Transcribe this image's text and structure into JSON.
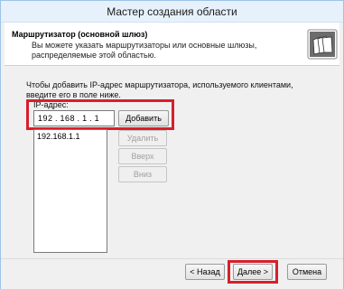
{
  "window": {
    "title": "Мастер создания области"
  },
  "header": {
    "title": "Маршрутизатор (основной шлюз)",
    "description": "Вы можете указать маршрутизаторы или основные шлюзы, распределяемые этой областью."
  },
  "main": {
    "intro": "Чтобы добавить IP-адрес маршрутизатора, используемого клиентами, введите его в поле ниже.",
    "ip_label": "IP-адрес:",
    "ip_octets": [
      "192",
      "168",
      "1",
      "1"
    ],
    "list_items": [
      "192.168.1.1"
    ],
    "buttons": {
      "add": "Добавить",
      "remove": "Удалить",
      "up": "Вверх",
      "down": "Вниз"
    }
  },
  "footer": {
    "back": "< Назад",
    "next": "Далее >",
    "cancel": "Отмена"
  },
  "colors": {
    "highlight": "#d7202b",
    "title_bar": "#e6f1fb"
  }
}
